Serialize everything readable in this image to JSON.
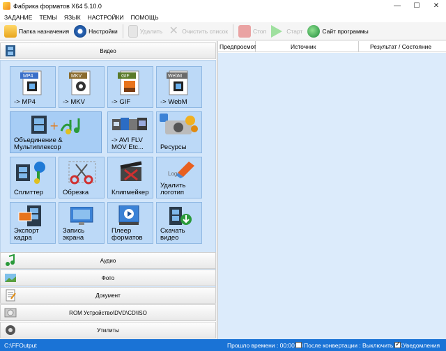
{
  "window": {
    "title": "Фабрика форматов X64 5.10.0"
  },
  "menu": [
    "ЗАДАНИЕ",
    "ТЕМЫ",
    "ЯЗЫК",
    "НАСТРОЙКИ",
    "ПОМОЩЬ"
  ],
  "toolbar": {
    "output_folder": "Папка назначения",
    "settings": "Настройки",
    "remove": "Удалить",
    "clear_list": "Очистить список",
    "stop": "Стоп",
    "start": "Старт",
    "website": "Сайт программы"
  },
  "categories": {
    "video": "Видео",
    "audio": "Аудио",
    "photo": "Фото",
    "document": "Документ",
    "rom": "ROM Устройство\\DVD\\CD\\ISO",
    "utilities": "Утилиты"
  },
  "tiles": [
    {
      "label": "-> MP4",
      "badge": "MP4",
      "badge_color": "#3a6fc9"
    },
    {
      "label": "-> MKV",
      "badge": "MKV",
      "badge_color": "#8a6b2e"
    },
    {
      "label": "-> GIF",
      "badge": "GIF",
      "badge_color": "#5a7a2a"
    },
    {
      "label": "-> WebM",
      "badge": "WebM",
      "badge_color": "#6b6b6b"
    },
    {
      "label": "Объединение &\nМультиплексор"
    },
    {
      "label": "-> AVI FLV\nMOV Etc..."
    },
    {
      "label": "Ресурсы"
    },
    {
      "label": "Сплиттер"
    },
    {
      "label": "Обрезка"
    },
    {
      "label": "Клипмейкер"
    },
    {
      "label": "Удалить\nлоготип"
    },
    {
      "label": "Экспорт\nкадра"
    },
    {
      "label": "Запись\nэкрана"
    },
    {
      "label": "Плеер\nформатов"
    },
    {
      "label": "Скачать\nвидео"
    }
  ],
  "table": {
    "columns": [
      "Предпросмотр",
      "Источник",
      "Результат / Состояние"
    ]
  },
  "status": {
    "output_path": "C:\\FFOutput",
    "elapsed_label": "Прошло времени : 00:00:00",
    "after_convert_label": "После конвертации : Выключить ПК",
    "after_convert_checked": false,
    "notifications_label": "Уведомления",
    "notifications_checked": true
  },
  "colors": {
    "accent": "#1a73d6",
    "grid_bg": "#d3e6fa",
    "tile_bg": "#bcd9f7"
  }
}
